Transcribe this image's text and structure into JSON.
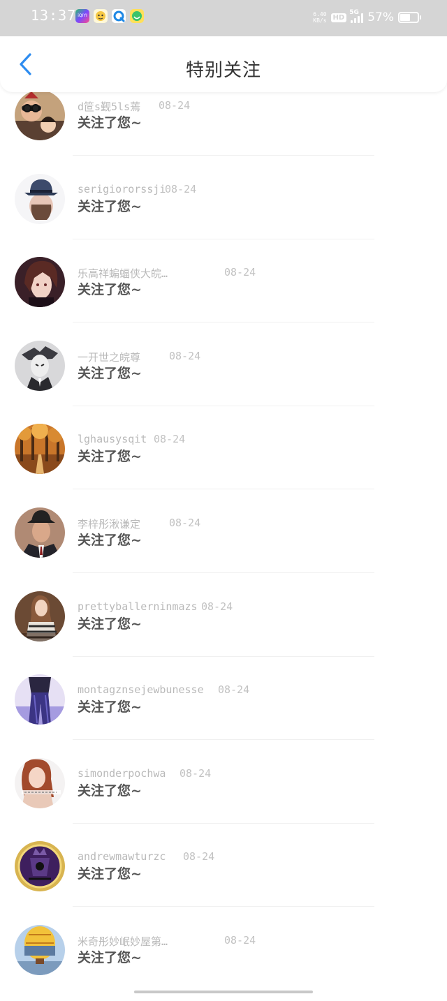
{
  "status_bar": {
    "time": "13:37",
    "net_speed_value": "6.40",
    "net_speed_unit": "KB/s",
    "hd_label": "HD",
    "network_label": "5G",
    "battery_percent": "57%",
    "battery_level": 0.57,
    "app_icons": [
      "iqiyi-app-icon",
      "qq-browser-face-icon",
      "qq-browser-icon",
      "smile-app-icon"
    ]
  },
  "header": {
    "title": "特别关注",
    "accent_color": "#2d8cf0"
  },
  "items": [
    {
      "username": "d笸s觐5ls蔫",
      "date": "08-24",
      "action": "关注了您~"
    },
    {
      "username": "serigiororssji",
      "date": "08-24",
      "action": "关注了您~"
    },
    {
      "username": "乐高祥蝙蝠侠大皖…",
      "date": "08-24",
      "action": "关注了您~"
    },
    {
      "username": "一开世之皖尊",
      "date": "08-24",
      "action": "关注了您~"
    },
    {
      "username": "lghausysqit",
      "date": "08-24",
      "action": "关注了您~"
    },
    {
      "username": "李梓彤湫谦定",
      "date": "08-24",
      "action": "关注了您~"
    },
    {
      "username": "prettyballerninmazs",
      "date": "08-24",
      "action": "关注了您~"
    },
    {
      "username": "montagznsejewbunesse",
      "date": "08-24",
      "action": "关注了您~"
    },
    {
      "username": "simonderpochwa",
      "date": "08-24",
      "action": "关注了您~"
    },
    {
      "username": "andrewmawturzc",
      "date": "08-24",
      "action": "关注了您~"
    },
    {
      "username": "米奇彤妙岷妙屋第…",
      "date": "08-24",
      "action": "关注了您~"
    }
  ]
}
